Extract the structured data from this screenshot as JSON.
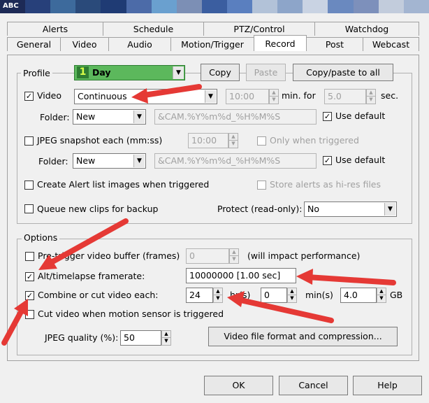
{
  "window": {
    "title": "ABC",
    "titlebar_colors": [
      "#1d2a56",
      "#27407a",
      "#3d6a9c",
      "#2a4a7a",
      "#1f3b74",
      "#4c6ba8",
      "#6aa0cf",
      "#7c8fb5",
      "#3b5ea0",
      "#5a7fbf",
      "#b2c2d8",
      "#8da5c9",
      "#c9d3e3",
      "#6a89bf",
      "#7d90bb",
      "#c2ccdc",
      "#a3b5d1"
    ]
  },
  "tabs": {
    "row1": [
      "Alerts",
      "Schedule",
      "PTZ/Control",
      "Watchdog"
    ],
    "row2": [
      "General",
      "Video",
      "Audio",
      "Motion/Trigger",
      "Record",
      "Post",
      "Webcast"
    ],
    "active": "Record"
  },
  "profile": {
    "label": "Profile",
    "badge_number": "1",
    "name": "Day",
    "badge_color": "#5cb85c",
    "copy": "Copy",
    "paste": "Paste",
    "copy_paste_all": "Copy/paste to all"
  },
  "record": {
    "video_label": "Video",
    "video_mode": "Continuous",
    "min_value": "10:00",
    "min_for_label": "min. for",
    "sec_value": "5.0",
    "sec_label": "sec.",
    "folder_label": "Folder:",
    "folder_value": "New",
    "folder_pattern": "&CAM.%Y%m%d_%H%M%S",
    "use_default": "Use default",
    "jpeg_label": "JPEG snapshot each (mm:ss)",
    "jpeg_interval": "10:00",
    "only_triggered": "Only when triggered",
    "folder2_label": "Folder:",
    "folder2_value": "New",
    "folder2_pattern": "&CAM.%Y%m%d_%H%M%S",
    "use_default2": "Use default",
    "alert_images": "Create Alert list images when triggered",
    "store_hires": "Store alerts as hi-res files",
    "queue_backup": "Queue new clips for backup",
    "protect_label": "Protect (read-only):",
    "protect_value": "No"
  },
  "options": {
    "label": "Options",
    "pretrigger_label": "Pre-trigger video buffer (frames)",
    "pretrigger_value": "0",
    "pretrigger_note": "(will impact performance)",
    "alt_framerate_label": "Alt/timelapse framerate:",
    "alt_framerate_value": "10000000 [1.00 sec]",
    "combine_label": "Combine or cut video each:",
    "hours_value": "24",
    "hours_unit": "hr(s)",
    "mins_value": "0",
    "mins_unit": "min(s)",
    "gb_value": "4.0",
    "gb_unit": "GB",
    "cut_motion_label": "Cut video when motion sensor is triggered",
    "jpeg_quality_label": "JPEG quality (%):",
    "jpeg_quality_value": "50",
    "video_format_button": "Video file format and compression..."
  },
  "footer": {
    "ok": "OK",
    "cancel": "Cancel",
    "help": "Help"
  },
  "annotation": {
    "arrow_color": "#e53935"
  }
}
